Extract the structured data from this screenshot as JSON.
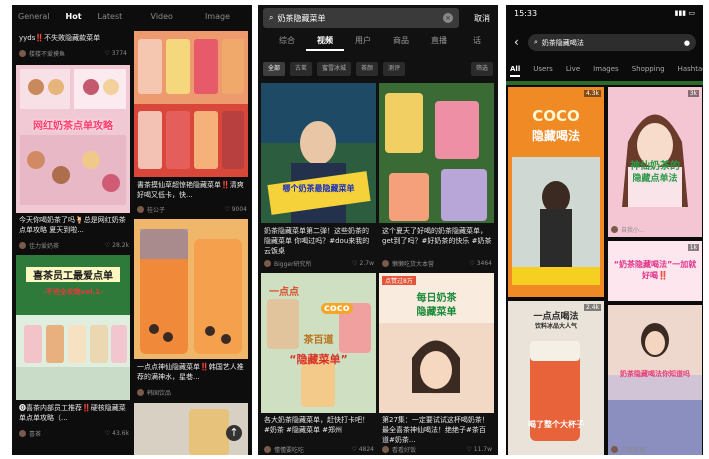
{
  "colors": {
    "dark_bg": "#0d0d0d",
    "accent_red": "#ff2d55",
    "green_strip": "#2a6b2a"
  },
  "phone1": {
    "tabs": [
      "General",
      "Hot",
      "Latest"
    ],
    "active_tab": "Hot",
    "right_tabs": [
      "Video",
      "Image"
    ],
    "cards": [
      {
        "caption": "yyds‼️不失敗隐藏款菜单",
        "author": "楼楼不爱摸鱼",
        "likes": "3774"
      },
      {
        "caption": "書茶摸仙草超惊艳隐藏菜单‼️清爽好喝又低卡，快...",
        "author": "桂公子",
        "likes": "9004"
      },
      {
        "caption": "今天你喝奶茶了吗🍹总是网红奶茶点单攻略 夏天到啦...",
        "author": "佳力爱奶茶",
        "likes": "28.2k"
      },
      {
        "caption": "一点点神仙隐藏菜单‼️韩国艺人推荐的满神水，星巷...",
        "author": "韩国饮品",
        "likes": ""
      },
      {
        "caption": "🅞喜茶内部员工推荐‼️硬核隐藏菜单点单攻略（...",
        "author": "喜茶",
        "likes": "43.6k"
      }
    ],
    "card1_title": "网红奶茶点单攻略",
    "card3_title": "喜茶员工最爱点单",
    "card3_subtitle": "-不完全攻略vol.1-"
  },
  "phone2": {
    "search_query": "奶茶隐藏菜单",
    "cancel_label": "取消",
    "tabs": [
      "综合",
      "视频",
      "用户",
      "商品",
      "直播",
      "话"
    ],
    "active_tab": "视频",
    "filters": [
      "全部",
      "古茗",
      "蜜雪冰城",
      "茶颜",
      "测评",
      "筛选"
    ],
    "cards": [
      {
        "caption": "奶茶隐藏菜单第二弹！这些奶茶的隐藏菜单 你喝过吗？#dou来我的云饭桌",
        "author": "Bigger研究所",
        "likes": "2.7w"
      },
      {
        "caption": "这个夏天了好喝的奶茶隐藏菜单，get到了吗？#好奶茶的快乐 #奶茶",
        "author": "懒懒吃货大本营",
        "likes": "3464"
      },
      {
        "caption": "各大奶茶隐藏菜单，赶快打卡吧！#奶茶 #隐藏菜单 #郑州",
        "author": "懂懂要吃吃",
        "likes": "4824"
      },
      {
        "caption": "第27集：一定要试试这杯喝奶茶！最全喜茶神仙喝法！绝绝子#茶百道#奶茶...",
        "author": "看看好饭",
        "likes": "11.7w"
      }
    ],
    "card1_overlay": "哪个奶茶最隐藏菜单",
    "card3_overlay_line1": "coco",
    "card3_overlay_line2": "茶百道",
    "card3_overlay_line3": "“隐藏菜单”",
    "card3_topleft": "一点点",
    "card4_badge": "点赞过8万",
    "card4_overlay_line1": "每日奶茶",
    "card4_overlay_line2": "隐藏菜单"
  },
  "phone3": {
    "time": "15:33",
    "search_query": "奶茶隐藏喝法",
    "tabs": [
      "All",
      "Users",
      "Live",
      "Images",
      "Shopping",
      "Hashtags"
    ],
    "active_tab": "All",
    "cards": [
      {
        "duration": "4.3k",
        "overlay1": "COCO",
        "overlay2": "隐藏喝法",
        "author": "不不不..."
      },
      {
        "duration": "3k",
        "overlay1": "神仙奶茶的",
        "overlay2": "隐藏点单法",
        "author": "自我小..."
      },
      {
        "duration": "2.4k",
        "overlay1": "一点点喝法",
        "overlay2": "饮料冰品大人气",
        "author": ""
      },
      {
        "duration": "1k",
        "overlay1": "“奶茶隐藏喝法”一加就好喝‼️",
        "author": ""
      },
      {
        "duration": "",
        "overlay1": "奶茶隐藏喝法你知道吗",
        "author": "三饭茶铺"
      }
    ],
    "bottom_labels": [
      "喝了整个大杯子",
      "奶茶隐藏喝法你知道吗"
    ]
  }
}
